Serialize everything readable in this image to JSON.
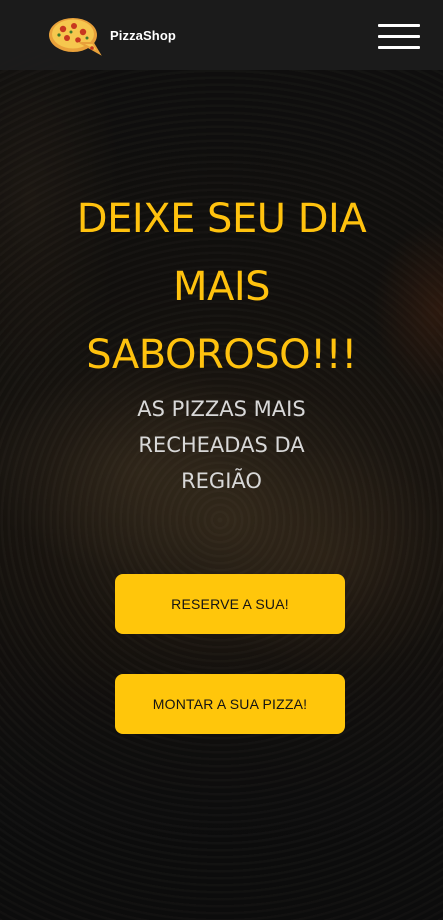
{
  "navbar": {
    "brand": "PizzaShop",
    "logo_icon": "pizza-logo-icon",
    "menu_icon": "hamburger-menu-icon"
  },
  "hero": {
    "title_lines": [
      "DEIXE SEU DIA",
      "MAIS",
      "SABOROSO!!!"
    ],
    "subtitle_lines": [
      "AS PIZZAS MAIS",
      "RECHEADAS DA",
      "REGIÃO"
    ]
  },
  "buttons": {
    "reserve_label": "RESERVE A SUA!",
    "build_label": "MONTAR A SUA PIZZA!"
  },
  "colors": {
    "accent": "#ffc60b",
    "title": "#ffc20e",
    "navbar": "#1c1c1c",
    "text_light": "#d8d8d8"
  }
}
